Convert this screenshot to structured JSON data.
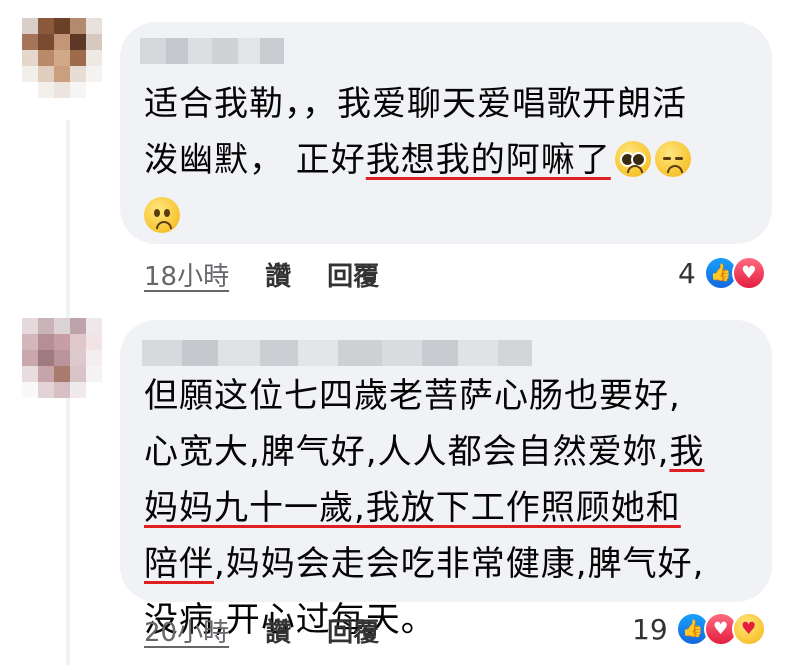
{
  "comments": [
    {
      "lines": [
        [
          {
            "text": "适合我勒，，我爱聊天爱唱歌开朗活",
            "underline": false
          }
        ],
        [
          {
            "text": "泼幽默， 正好",
            "underline": false
          },
          {
            "text": "我想我的阿嘛了",
            "underline": true
          }
        ],
        []
      ],
      "emojis": [
        "pleading-face",
        "pensive-face",
        "slightly-frowning-face"
      ],
      "time": "18小時",
      "like_label": "讚",
      "reply_label": "回覆",
      "reaction_count": "4",
      "reactions": [
        "like",
        "love"
      ]
    },
    {
      "lines": [
        [
          {
            "text": "但願这位七四歲老菩萨心肠也要好,",
            "underline": false
          }
        ],
        [
          {
            "text": "心宽大,脾气好,人人都会自然爱妳,",
            "underline": false
          },
          {
            "text": "我",
            "underline": true
          }
        ],
        [
          {
            "text": "妈妈九十一歲,我放下工作照顾她和",
            "underline": true
          }
        ],
        [
          {
            "text": "陪伴",
            "underline": true
          },
          {
            "text": ",妈妈会走会吃非常健康,脾气好,",
            "underline": false
          }
        ],
        [
          {
            "text": "没病,开心过每天。",
            "underline": false
          }
        ]
      ],
      "time": "20小時",
      "like_label": "讚",
      "reply_label": "回覆",
      "reaction_count": "19",
      "reactions": [
        "like",
        "love",
        "care"
      ]
    }
  ],
  "colors": {
    "bubble": "#f0f2f5",
    "underline_accent": "#e02020",
    "meta_text": "#65676b",
    "like_blue": "#1877f2",
    "love_red": "#e41e3f"
  }
}
